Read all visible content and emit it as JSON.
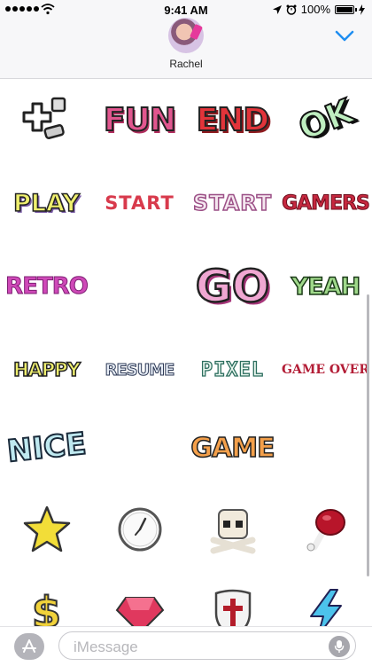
{
  "status_bar": {
    "time": "9:41 AM",
    "battery": "100%",
    "battery_level": 1.0,
    "icons": [
      "signal-dots-icon",
      "wifi-icon",
      "location-arrow-icon",
      "alarm-icon",
      "charging-bolt-icon"
    ]
  },
  "header": {
    "contact_name": "Rachel",
    "avatar": "contact-avatar",
    "collapse_icon": "chevron-down-icon"
  },
  "stickers": {
    "row1": {
      "fun": "FUN",
      "end": "END",
      "ok": "OK",
      "gamepad": "gamepad-dice-icon"
    },
    "row2": {
      "play": "PLAY",
      "start1": "START",
      "start2": "START",
      "gamers": "GAMERS"
    },
    "row3": {
      "retro": "RETRO",
      "go": "GO",
      "yeah": "YEAH"
    },
    "row4": {
      "happy": "HAPPY",
      "resume": "RESUME",
      "pixel": "PIXEL",
      "gameover": "GAME OVER"
    },
    "row5": {
      "nice": "NICE",
      "game": "GAME"
    },
    "row6": [
      "star-icon",
      "clock-icon",
      "skull-crossbones-icon",
      "meat-drumstick-icon"
    ],
    "row7": {
      "dollar": "$",
      "icons": [
        "dollar-sign-icon",
        "gem-icon",
        "shield-icon",
        "lightning-bolt-icon"
      ]
    }
  },
  "input_bar": {
    "placeholder": "iMessage",
    "app_store_icon": "app-store-icon",
    "mic_icon": "microphone-icon"
  },
  "colors": {
    "accent": "#1f8ef1",
    "pink": "#e2568f",
    "red": "#e2343a",
    "green": "#9fd88a",
    "yellow": "#efef6e",
    "orange": "#f4a04b"
  }
}
